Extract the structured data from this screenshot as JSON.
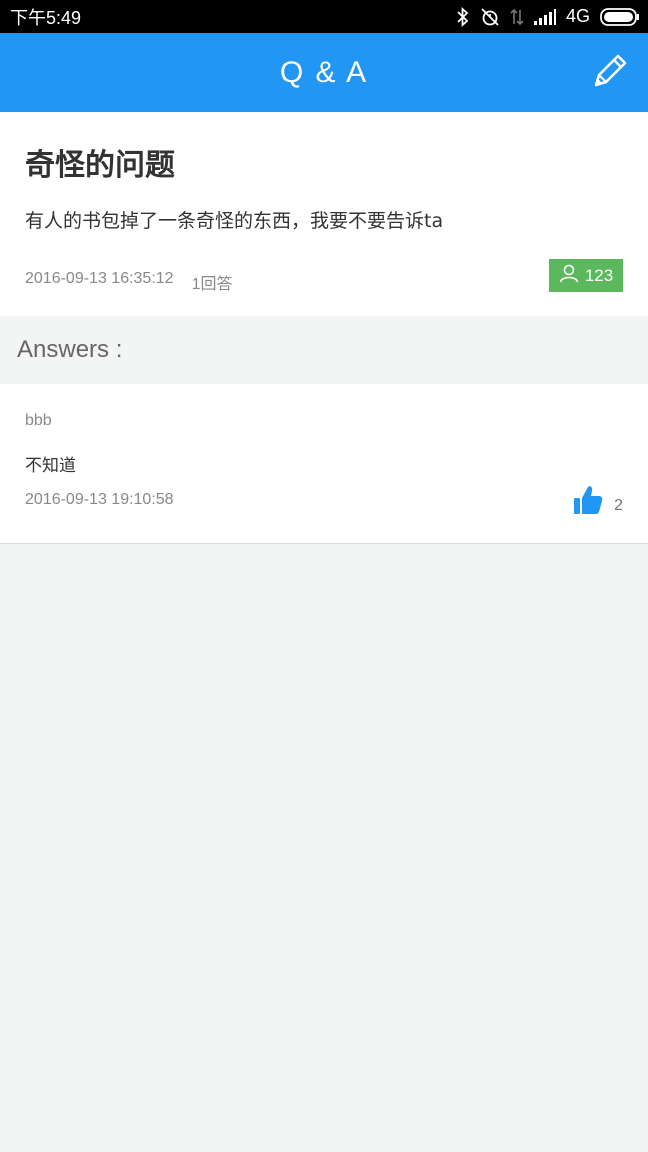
{
  "status_bar": {
    "time": "下午5:49",
    "network": "4G",
    "icons": [
      "bluetooth-icon",
      "alarm-off-icon",
      "data-transfer-icon",
      "signal-icon",
      "battery-icon"
    ]
  },
  "app_bar": {
    "title": "Q & A",
    "edit_icon": "pencil-icon"
  },
  "question": {
    "title": "奇怪的问题",
    "body": "有人的书包掉了一条奇怪的东西，我要不要告诉ta",
    "timestamp": "2016-09-13 16:35:12",
    "answer_count": "1回答",
    "views": "123",
    "badge_color": "#5cb85c"
  },
  "answers_section": {
    "title": "Answers :"
  },
  "answers": [
    {
      "author": "bbb",
      "content": "不知道",
      "timestamp": "2016-09-13 19:10:58",
      "likes": "2"
    }
  ],
  "colors": {
    "primary": "#2196f3",
    "background": "#f3f4f4",
    "like": "#2196f3"
  }
}
